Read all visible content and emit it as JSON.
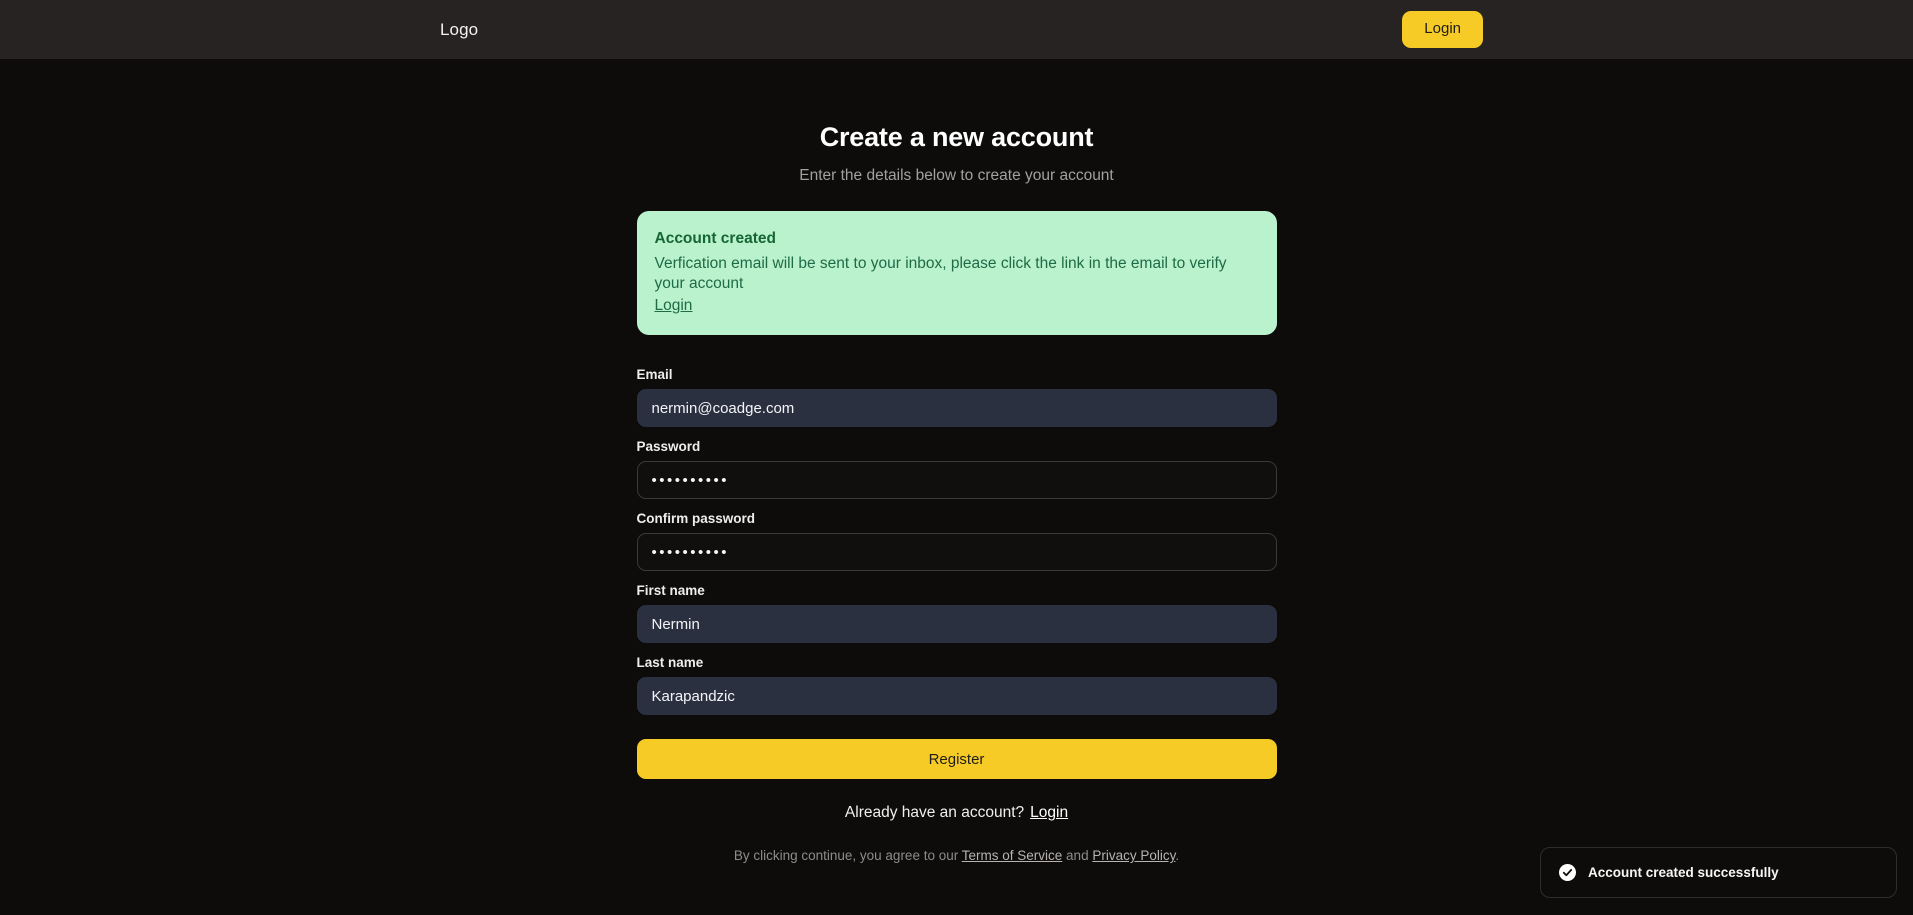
{
  "header": {
    "logo": "Logo",
    "login_label": "Login"
  },
  "main": {
    "title": "Create a new account",
    "subtitle": "Enter the details below to create your account"
  },
  "alert": {
    "title": "Account created",
    "message": "Verfication email will be sent to your inbox, please click the link in the email to verify your account",
    "link_label": "Login",
    "background_color": "#b9f2cd",
    "text_color": "#166534"
  },
  "form": {
    "fields": [
      {
        "label": "Email",
        "value": "nermin@coadge.com",
        "placeholder": "Email",
        "type": "email",
        "style": "autofilled",
        "name": "email"
      },
      {
        "label": "Password",
        "value": "••••••••••",
        "placeholder": "Password",
        "type": "password",
        "style": "plain",
        "name": "password"
      },
      {
        "label": "Confirm password",
        "value": "••••••••••",
        "placeholder": "Confirm password",
        "type": "password",
        "style": "plain",
        "name": "confirm-password"
      },
      {
        "label": "First name",
        "value": "Nermin",
        "placeholder": "First name",
        "type": "text",
        "style": "autofilled",
        "name": "first-name"
      },
      {
        "label": "Last name",
        "value": "Karapandzic",
        "placeholder": "Last name",
        "type": "text",
        "style": "autofilled",
        "name": "last-name"
      }
    ],
    "submit_label": "Register"
  },
  "footer": {
    "login_prompt": "Already have an account?",
    "login_link": "Login",
    "terms_prefix": "By clicking continue, you agree to our",
    "terms_link": "Terms of Service",
    "terms_conjunction": "and",
    "privacy_link": "Privacy Policy",
    "terms_suffix": "."
  },
  "toast": {
    "message": "Account created successfully",
    "icon": "check-circle-icon"
  },
  "theme": {
    "accent": "#f6cb26",
    "header_bg": "#262322",
    "page_bg": "#0d0c0b",
    "input_autofill_bg": "#2b3040"
  }
}
